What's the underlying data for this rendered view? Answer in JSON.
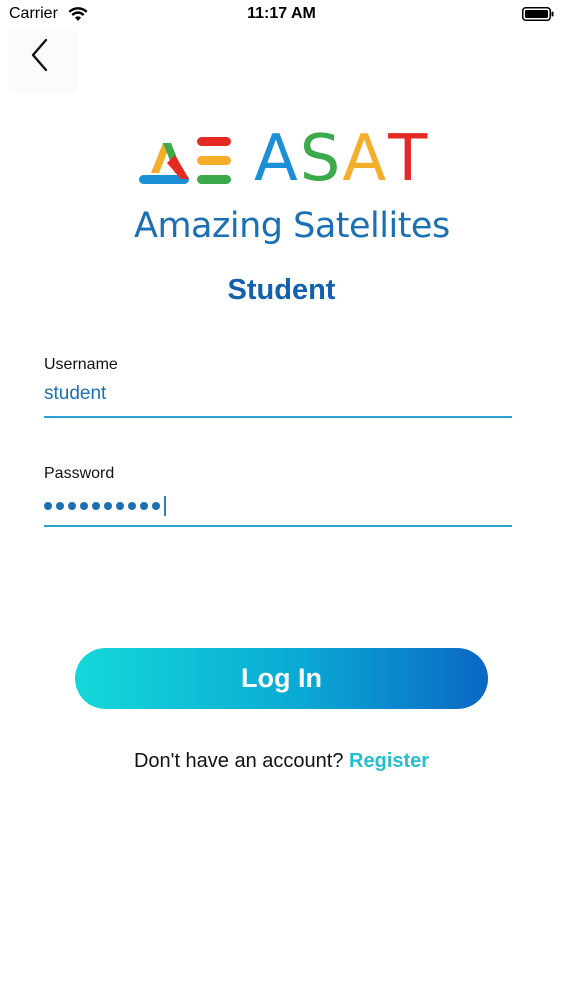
{
  "status_bar": {
    "carrier": "Carrier",
    "time": "11:17 AM",
    "wifi_icon": "wifi-icon",
    "battery_icon": "battery-icon"
  },
  "nav": {
    "back_icon": "chevron-left-icon"
  },
  "logo": {
    "letters": [
      "A",
      "S",
      "A",
      "T"
    ],
    "letter_colors": [
      "#1b8fd6",
      "#3aaa4a",
      "#f5ae2a",
      "#e52a24"
    ],
    "tagline": "Amazing Satellites"
  },
  "page_title": "Student",
  "form": {
    "username_label": "Username",
    "username_value": "student",
    "password_label": "Password",
    "password_length": 10
  },
  "login_button_label": "Log In",
  "register": {
    "prompt": "Don't have an account?",
    "link_label": "Register"
  },
  "colors": {
    "brand_blue": "#1360ad",
    "accent_teal": "#22bfcf",
    "input_underline": "#2aa3d3"
  }
}
